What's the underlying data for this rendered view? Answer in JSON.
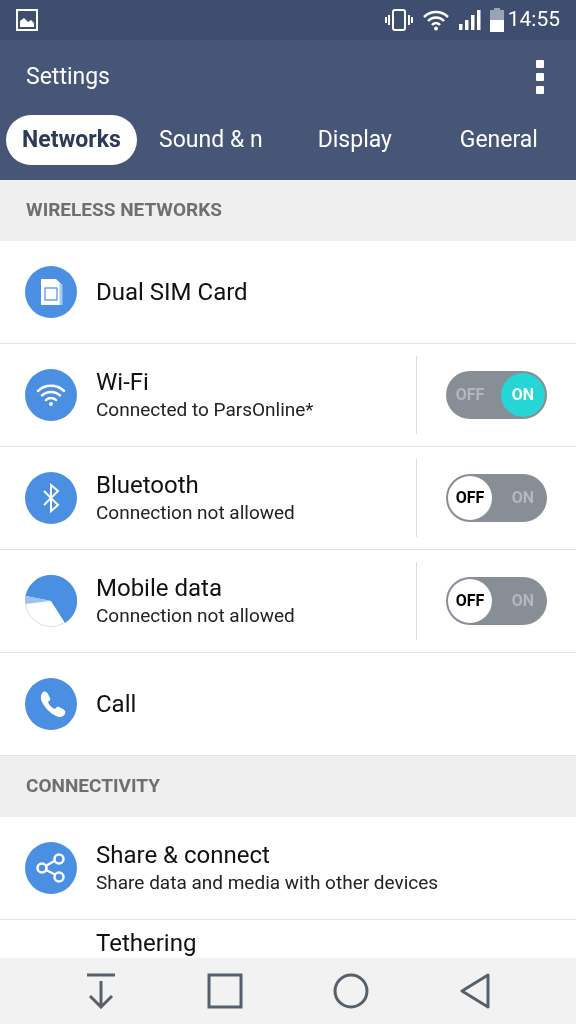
{
  "status_bar": {
    "time": "14:55"
  },
  "app_bar": {
    "title": "Settings"
  },
  "tabs": [
    {
      "label": "Networks",
      "selected": true
    },
    {
      "label": "Sound & n",
      "selected": false
    },
    {
      "label": "Display",
      "selected": false
    },
    {
      "label": "General",
      "selected": false
    }
  ],
  "sections": [
    {
      "header": "WIRELESS NETWORKS",
      "items": [
        {
          "kind": "link",
          "title": "Dual SIM Card"
        },
        {
          "kind": "toggle",
          "title": "Wi-Fi",
          "subtitle": "Connected to ParsOnline*",
          "on": true,
          "off_label": "OFF",
          "on_label": "ON"
        },
        {
          "kind": "toggle",
          "title": "Bluetooth",
          "subtitle": "Connection not allowed",
          "on": false,
          "off_label": "OFF",
          "on_label": "ON"
        },
        {
          "kind": "toggle",
          "title": "Mobile data",
          "subtitle": "Connection not allowed",
          "on": false,
          "off_label": "OFF",
          "on_label": "ON"
        },
        {
          "kind": "link",
          "title": "Call"
        }
      ]
    },
    {
      "header": "CONNECTIVITY",
      "items": [
        {
          "kind": "link",
          "title": "Share & connect",
          "subtitle": "Share data and media with other devices"
        },
        {
          "kind": "link",
          "title": "Tethering"
        }
      ]
    }
  ]
}
